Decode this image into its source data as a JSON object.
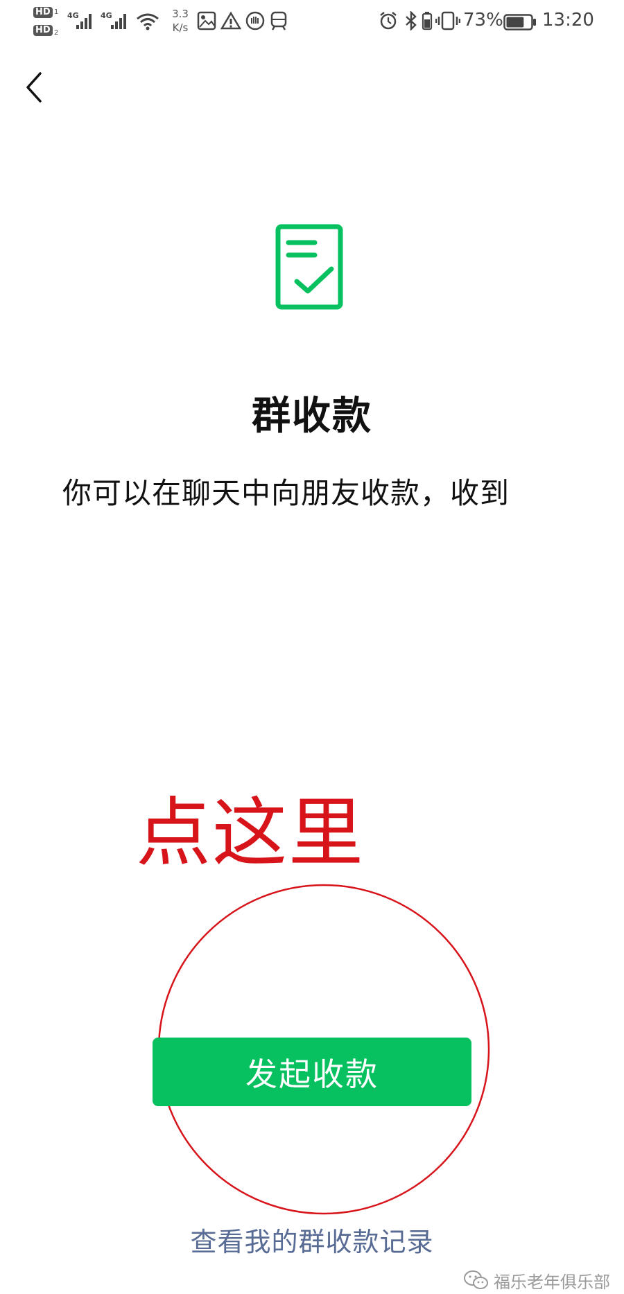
{
  "status_bar": {
    "hd1": "HD",
    "hd1_sub": "1",
    "hd2": "HD",
    "hd2_sub": "2",
    "net1": "4G",
    "net2": "4G",
    "speed_value": "3.3",
    "speed_unit": "K/s",
    "icons": [
      "image-icon",
      "warning-icon",
      "hand-icon",
      "train-icon",
      "alarm-icon",
      "bluetooth-icon",
      "vibrate-icon",
      "battery-icon"
    ],
    "battery_percent": "73%",
    "battery_level": 0.73,
    "time": "13:20"
  },
  "nav": {
    "back_icon": "chevron-left-icon"
  },
  "main": {
    "icon": "document-check-icon",
    "accent_color": "#07c160",
    "title": "群收款",
    "description": "你可以在聊天中向朋友收款，收到"
  },
  "annotation": {
    "text": "点这里",
    "color": "#d8141b"
  },
  "actions": {
    "primary_button": "发起收款",
    "records_link": "查看我的群收款记录",
    "link_color": "#576b95"
  },
  "watermark": {
    "icon": "wechat-icon",
    "text": "福乐老年俱乐部"
  }
}
